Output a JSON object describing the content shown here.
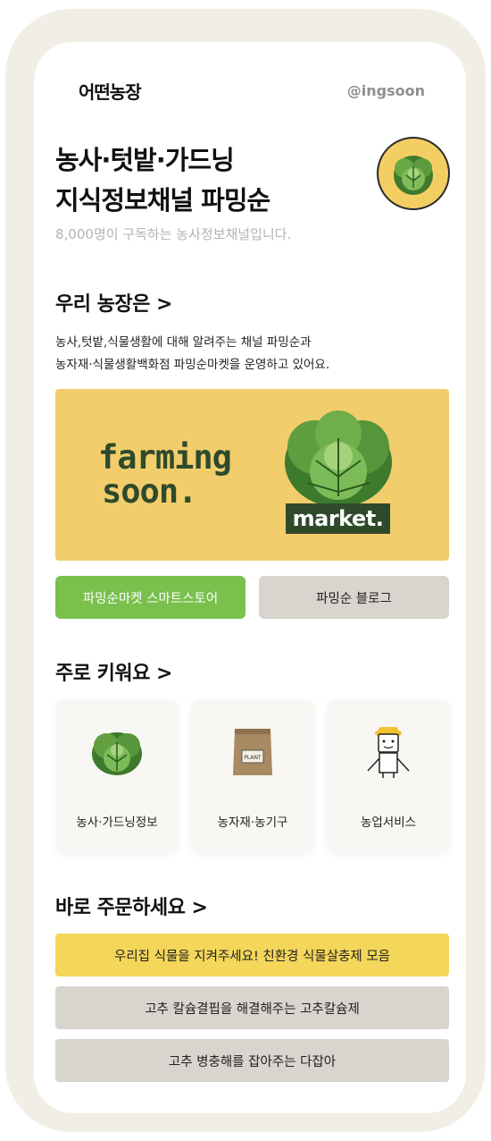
{
  "header": {
    "logo": "어떤농장",
    "handle": "@ingsoon"
  },
  "hero": {
    "title_line1": "농사·텃밭·가드닝",
    "title_line2": "지식정보채널 파밍순",
    "subtitle": "8,000명이 구독하는 농사정보채널입니다."
  },
  "about": {
    "heading": "우리 농장은 >",
    "desc_line1": "농사,텃밭,식물생활에 대해 알려주는 채널 파밍순과",
    "desc_line2": "농자재·식물생활백화점 파밍순마켓을 운영하고 있어요.",
    "banner_text_line1": "farming",
    "banner_text_line2": "soon.",
    "banner_market": "market."
  },
  "buttons": {
    "smartstore": "파밍순마켓 스마트스토어",
    "blog": "파밍순 블로그"
  },
  "grow": {
    "heading": "주로 키워요 >",
    "cards": [
      {
        "label": "농사·가드닝정보",
        "icon": "lettuce-icon"
      },
      {
        "label": "농자재·농기구",
        "icon": "seed-bag-icon"
      },
      {
        "label": "농업서비스",
        "icon": "farmer-icon"
      }
    ],
    "bag_text": "PLANT"
  },
  "order": {
    "heading": "바로 주문하세요 >",
    "items": [
      "우리집 식물을 지켜주세요! 친환경 식물살충제 모음",
      "고추 칼슘결핍을 해결해주는 고추칼슘제",
      "고추 병충해를 잡아주는 다잡아"
    ]
  },
  "colors": {
    "accent_yellow": "#f2cd6c",
    "brand_green": "#79c04d",
    "dark_green": "#2e4a2b",
    "neutral_gray": "#d8d4ce"
  }
}
